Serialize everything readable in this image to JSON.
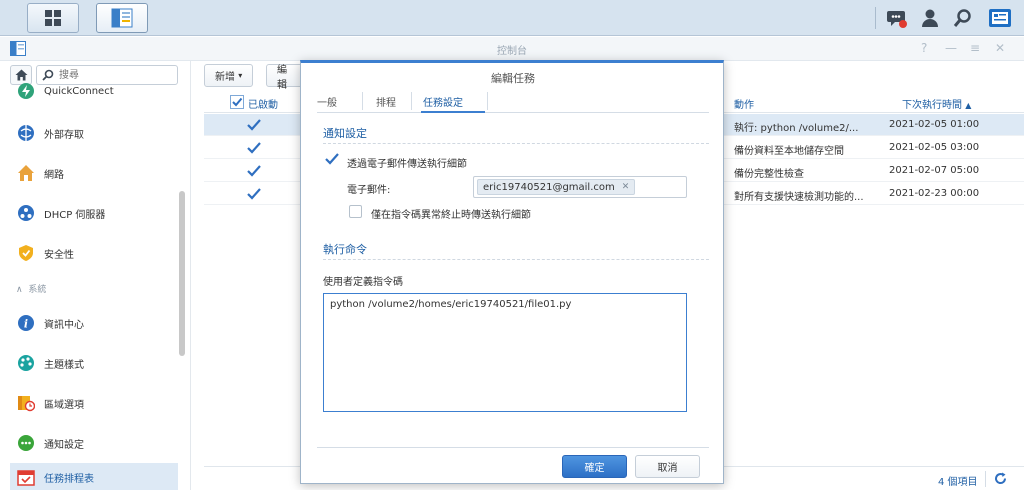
{
  "window": {
    "title": "控制台"
  },
  "taskbar": {
    "icons": [
      "apps-grid-icon",
      "control-panel-icon",
      "notification-chat-icon",
      "user-icon",
      "search-icon",
      "widgets-icon"
    ]
  },
  "sidebar": {
    "search_placeholder": "搜尋",
    "section_label": "系統",
    "items": [
      {
        "label": "QuickConnect",
        "icon": "quickconnect-icon"
      },
      {
        "label": "外部存取",
        "icon": "external-access-icon"
      },
      {
        "label": "網路",
        "icon": "network-icon"
      },
      {
        "label": "DHCP 伺服器",
        "icon": "dhcp-server-icon"
      },
      {
        "label": "安全性",
        "icon": "security-shield-icon"
      },
      {
        "label": "資訊中心",
        "icon": "info-center-icon"
      },
      {
        "label": "主題樣式",
        "icon": "theme-palette-icon"
      },
      {
        "label": "區域選項",
        "icon": "regional-options-icon"
      },
      {
        "label": "通知設定",
        "icon": "notification-icon"
      },
      {
        "label": "任務排程表",
        "icon": "task-scheduler-icon"
      }
    ]
  },
  "toolbar": {
    "create_label": "新增",
    "edit_label": "編輯"
  },
  "grid": {
    "col_enabled": "已啟動",
    "col_action": "動作",
    "col_next_run": "下次執行時間",
    "rows": [
      {
        "action": "執行: python /volume2/...",
        "next_run": "2021-02-05 01:00"
      },
      {
        "action": "備份資料至本地儲存空間",
        "next_run": "2021-02-05 03:00"
      },
      {
        "action": "備份完整性檢查",
        "next_run": "2021-02-07 05:00"
      },
      {
        "action": "對所有支援快速檢測功能的...",
        "next_run": "2021-02-23 00:00"
      }
    ],
    "footer_count": "4 個項目"
  },
  "dialog": {
    "title": "編輯任務",
    "tabs": [
      "一般",
      "排程",
      "任務設定"
    ],
    "notify_section": "通知設定",
    "send_email_label": "透過電子郵件傳送執行細節",
    "email_label": "電子郵件:",
    "email_value": "eric19740521@gmail.com",
    "abnormal_only_label": "僅在指令碼異常終止時傳送執行細節",
    "run_section": "執行命令",
    "script_label": "使用者定義指令碼",
    "script_value": "python  /volume2/homes/eric19740521/file01.py",
    "ok_label": "確定",
    "cancel_label": "取消"
  },
  "colors": {
    "accent": "#3c7fd0",
    "selection": "#dde9f5",
    "link": "#1f5fa4"
  }
}
